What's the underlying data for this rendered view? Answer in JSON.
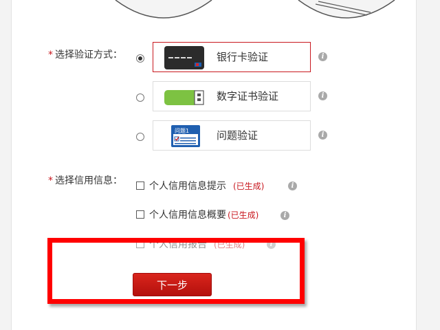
{
  "verification": {
    "label": "选择验证方式：",
    "required_mark": "*",
    "options": [
      {
        "label": "银行卡验证",
        "icon": "bank-card-icon",
        "selected": true
      },
      {
        "label": "数字证书验证",
        "icon": "usb-key-icon",
        "selected": false
      },
      {
        "label": "问题验证",
        "icon": "question-form-icon",
        "selected": false,
        "icon_text": "问题1"
      }
    ]
  },
  "credit_info": {
    "label": "选择信用信息：",
    "required_mark": "*",
    "items": [
      {
        "label": "个人信用信息提示",
        "status": "(已生成)"
      },
      {
        "label": "个人信用信息概要",
        "status": "(已生成)"
      },
      {
        "label": "个人信用报告",
        "status": "(已生成)"
      }
    ]
  },
  "next_button": {
    "label": "下一步"
  },
  "colors": {
    "accent": "#c8161d",
    "highlight": "#ff0000",
    "usb_green": "#7dc242",
    "card_dark": "#2b2b2b",
    "form_blue": "#1f5fb0"
  }
}
